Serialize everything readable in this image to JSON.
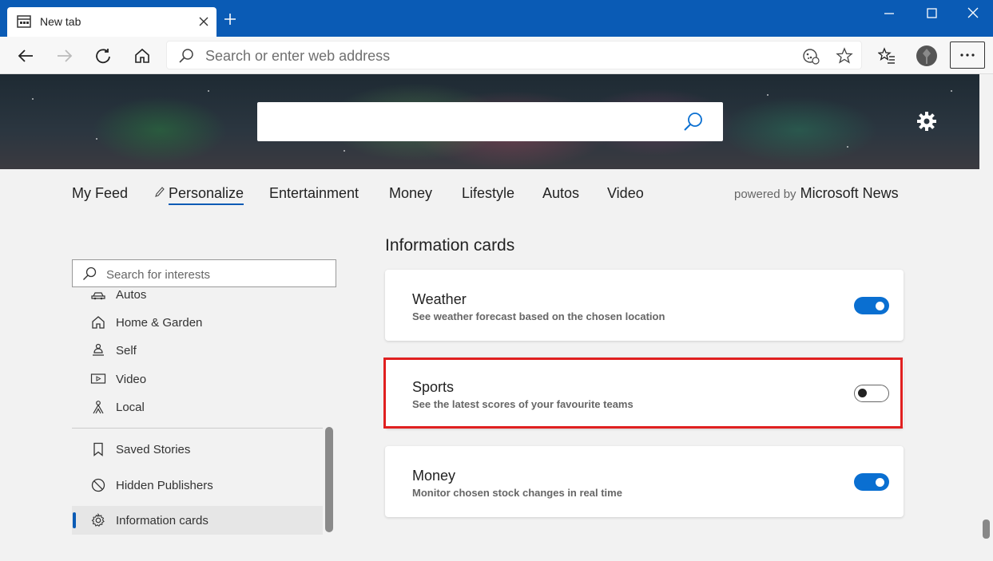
{
  "browser": {
    "tab_title": "New tab",
    "address_placeholder": "Search or enter web address"
  },
  "nav": {
    "items": [
      "My Feed",
      "Personalize",
      "Entertainment",
      "Money",
      "Lifestyle",
      "Autos",
      "Video"
    ],
    "active": "Personalize",
    "powered_prefix": "powered by",
    "powered_brand": "Microsoft News"
  },
  "sidebar": {
    "search_placeholder": "Search for interests",
    "interests": [
      {
        "label": "Autos",
        "icon": "car-icon"
      },
      {
        "label": "Home & Garden",
        "icon": "home-icon"
      },
      {
        "label": "Self",
        "icon": "self-icon"
      },
      {
        "label": "Video",
        "icon": "video-icon"
      },
      {
        "label": "Local",
        "icon": "local-icon"
      }
    ],
    "links": [
      {
        "label": "Saved Stories",
        "icon": "bookmark-icon"
      },
      {
        "label": "Hidden Publishers",
        "icon": "block-icon"
      },
      {
        "label": "Information cards",
        "icon": "gear-icon",
        "selected": true
      }
    ]
  },
  "main": {
    "section_title": "Information cards",
    "cards": [
      {
        "title": "Weather",
        "description": "See weather forecast based on the chosen location",
        "enabled": true
      },
      {
        "title": "Sports",
        "description": "See the latest scores of your favourite teams",
        "enabled": false
      },
      {
        "title": "Money",
        "description": "Monitor chosen stock changes in real time",
        "enabled": true
      }
    ]
  },
  "colors": {
    "accent": "#0a5bb5",
    "toggle_on": "#0a6fd1",
    "highlight_border": "#e02020"
  }
}
